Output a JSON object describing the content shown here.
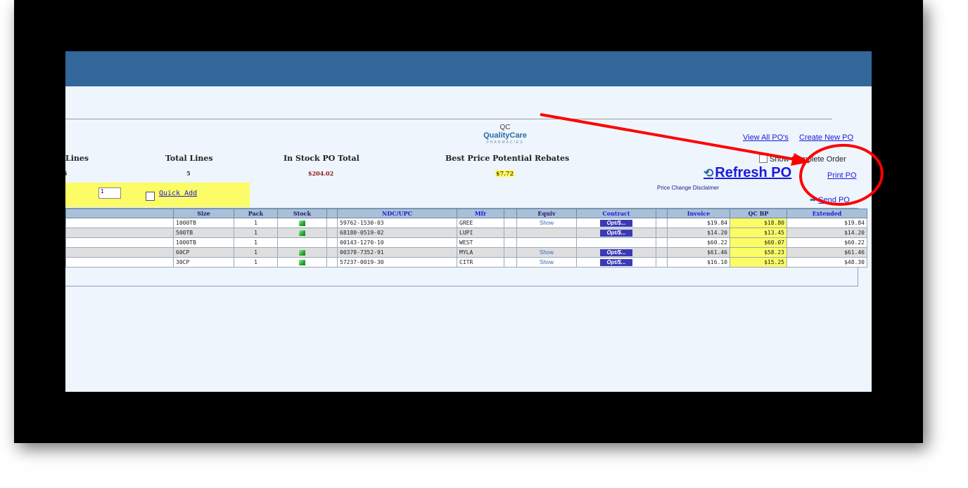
{
  "header": {
    "logo_mark": "QC",
    "logo_name": "QualityCare",
    "logo_sub": "PHARMACIES"
  },
  "summary": {
    "lines_label": "Lines",
    "lines_value": "5",
    "total_lines_label": "Total Lines",
    "total_lines_value": "5",
    "in_stock_label": "In Stock PO Total",
    "in_stock_value": "$204.02",
    "rebates_label": "Best Price Potential Rebates",
    "rebates_value": "$7.72"
  },
  "actions": {
    "view_all": "View All PO's",
    "create_new": "Create New PO",
    "show_complete": "Show Complete Order",
    "refresh": "Refresh PO",
    "print": "Print PO",
    "disclaimer": "Price Change Disclaimer",
    "send": "Send PO"
  },
  "quick_add": {
    "qty_value": "1",
    "label": "Quick Add"
  },
  "table": {
    "headers": {
      "size": "Size",
      "pack": "Pack",
      "stock": "Stock",
      "ndc": "NDC/UPC",
      "mfr": "Mfr",
      "equiv": "Equiv",
      "contract": "Contract",
      "invoice": "Invoice",
      "qcbp": "QC BP",
      "extended": "Extended"
    },
    "rows": [
      {
        "size": "1000TB",
        "pack": "1",
        "stock": true,
        "ndc": "59762-1530-03",
        "mfr": "GREE",
        "equiv": "Show",
        "contract": "Opt/$...",
        "invoice": "$19.84",
        "qcbp": "$18.80",
        "extended": "$19.84"
      },
      {
        "size": "500TB",
        "pack": "1",
        "stock": true,
        "ndc": "68180-0519-02",
        "mfr": "LUPI",
        "equiv": "",
        "contract": "Opt/$...",
        "invoice": "$14.20",
        "qcbp": "$13.45",
        "extended": "$14.20"
      },
      {
        "size": "1000TB",
        "pack": "1",
        "stock": false,
        "ndc": "00143-1270-10",
        "mfr": "WEST",
        "equiv": "",
        "contract": "",
        "invoice": "$60.22",
        "qcbp": "$60.07",
        "extended": "$60.22"
      },
      {
        "size": "60CP",
        "pack": "1",
        "stock": true,
        "ndc": "00378-7352-91",
        "mfr": "MYLA",
        "equiv": "Show",
        "contract": "Opt/$...",
        "invoice": "$61.46",
        "qcbp": "$58.23",
        "extended": "$61.46"
      },
      {
        "size": "30CP",
        "pack": "1",
        "stock": true,
        "ndc": "57237-0019-30",
        "mfr": "CITR",
        "equiv": "Show",
        "contract": "Opt/$...",
        "invoice": "$16.10",
        "qcbp": "$15.25",
        "extended": "$48.30"
      }
    ]
  },
  "colors": {
    "topbar": "#336699",
    "highlight": "#fcfc66",
    "annotation": "#ff0000",
    "link": "#1a1add"
  }
}
